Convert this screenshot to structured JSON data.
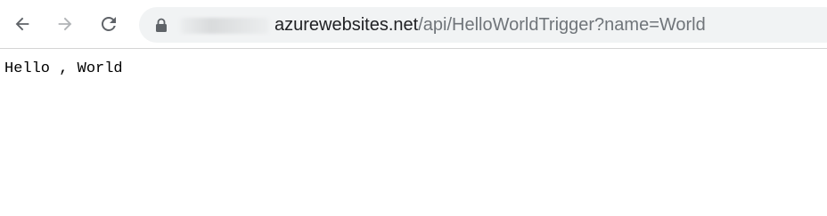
{
  "browser": {
    "toolbar": {
      "back_icon": "arrow-left-icon",
      "forward_icon": "arrow-right-icon",
      "reload_icon": "reload-icon",
      "colors": {
        "icon_active": "#5f6368",
        "icon_disabled": "#b0b3b6",
        "omnibox_bg": "#f1f3f4"
      }
    },
    "omnibox": {
      "lock_icon": "lock-icon",
      "host": "azurewebsites.net",
      "path": "/api/HelloWorldTrigger?name=World"
    }
  },
  "page": {
    "body_text": "Hello , World"
  }
}
